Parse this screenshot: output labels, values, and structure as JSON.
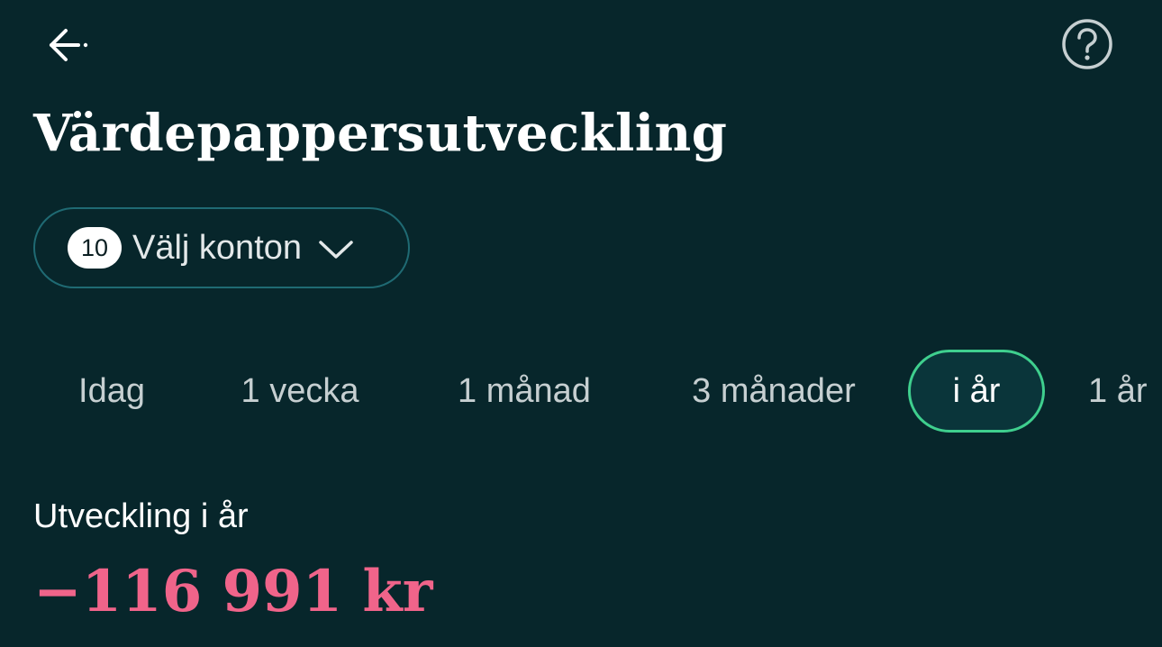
{
  "header": {
    "back_icon": "arrow-left-icon",
    "help_icon": "question-circle-icon"
  },
  "title": "Värdepappersutveckling",
  "account_selector": {
    "count": "10",
    "label": "Välj konton",
    "icon": "chevron-down-icon"
  },
  "period_tabs": [
    {
      "label": "Idag",
      "active": false
    },
    {
      "label": "1 vecka",
      "active": false
    },
    {
      "label": "1 månad",
      "active": false
    },
    {
      "label": "3 månader",
      "active": false
    },
    {
      "label": "i år",
      "active": true
    },
    {
      "label": "1 år",
      "active": false
    }
  ],
  "summary": {
    "label": "Utveckling i år",
    "value": "−116 991 kr"
  },
  "colors": {
    "background": "#07262b",
    "active_tab_border": "#3fcf8e",
    "negative_value": "#f0648a",
    "selector_border": "#1f6a73"
  }
}
